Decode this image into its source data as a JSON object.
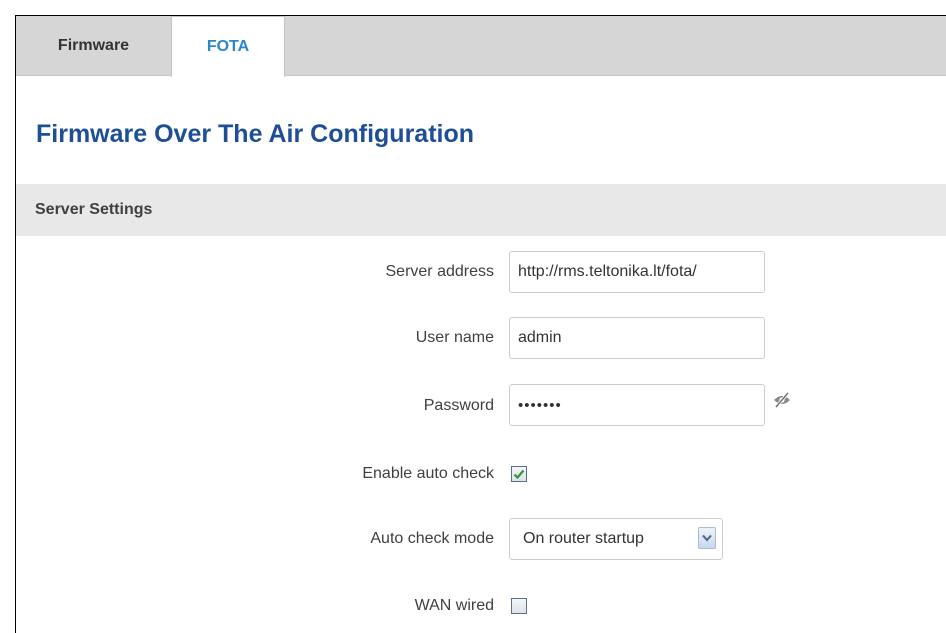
{
  "tabs": [
    {
      "label": "Firmware",
      "active": false
    },
    {
      "label": "FOTA",
      "active": true
    }
  ],
  "page_title": "Firmware Over The Air Configuration",
  "section": {
    "title": "Server Settings"
  },
  "form": {
    "server_address": {
      "label": "Server address",
      "value": "http://rms.teltonika.lt/fota/"
    },
    "user_name": {
      "label": "User name",
      "value": "admin"
    },
    "password": {
      "label": "Password",
      "value": "•••••••",
      "reveal_icon": "eye-slash-icon"
    },
    "enable_auto_check": {
      "label": "Enable auto check",
      "checked": true
    },
    "auto_check_mode": {
      "label": "Auto check mode",
      "value": "On router startup"
    },
    "wan_wired": {
      "label": "WAN wired",
      "checked": false
    }
  },
  "colors": {
    "title_blue": "#1e4f96",
    "active_tab": "#2a87c9",
    "tab_bar": "#d6d6d6",
    "section_bg": "#e8e8e8",
    "check_green": "#2e9b2e"
  }
}
